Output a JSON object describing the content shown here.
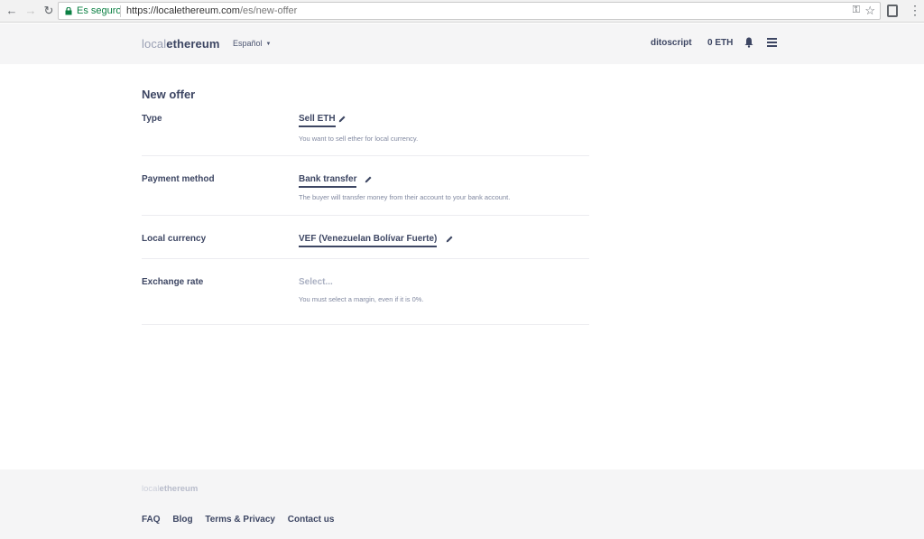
{
  "browser": {
    "secure_label": "Es seguro",
    "url_host": "https://localethereum.com",
    "url_path": "/es/new-offer"
  },
  "header": {
    "logo_part1": "local",
    "logo_part2": "ethereum",
    "language": "Español",
    "username": "ditoscript",
    "balance": "0 ETH"
  },
  "form": {
    "title": "New offer",
    "rows": [
      {
        "label": "Type",
        "value": "Sell ETH",
        "description": "You want to sell ether for local currency."
      },
      {
        "label": "Payment method",
        "value": "Bank transfer",
        "description": "The buyer will transfer money from their account to your bank account."
      },
      {
        "label": "Local currency",
        "value": "VEF (Venezuelan Bolívar Fuerte)",
        "description": ""
      },
      {
        "label": "Exchange rate",
        "value": "Select...",
        "description": "You must select a margin, even if it is 0%."
      }
    ]
  },
  "footer": {
    "logo_part1": "local",
    "logo_part2": "ethereum",
    "links": [
      "FAQ",
      "Blog",
      "Terms & Privacy",
      "Contact us"
    ]
  },
  "colors": {
    "primary": "#3d4663",
    "muted": "#8088a0",
    "header_bg": "#f5f5f6",
    "secure_green": "#0b8043"
  }
}
